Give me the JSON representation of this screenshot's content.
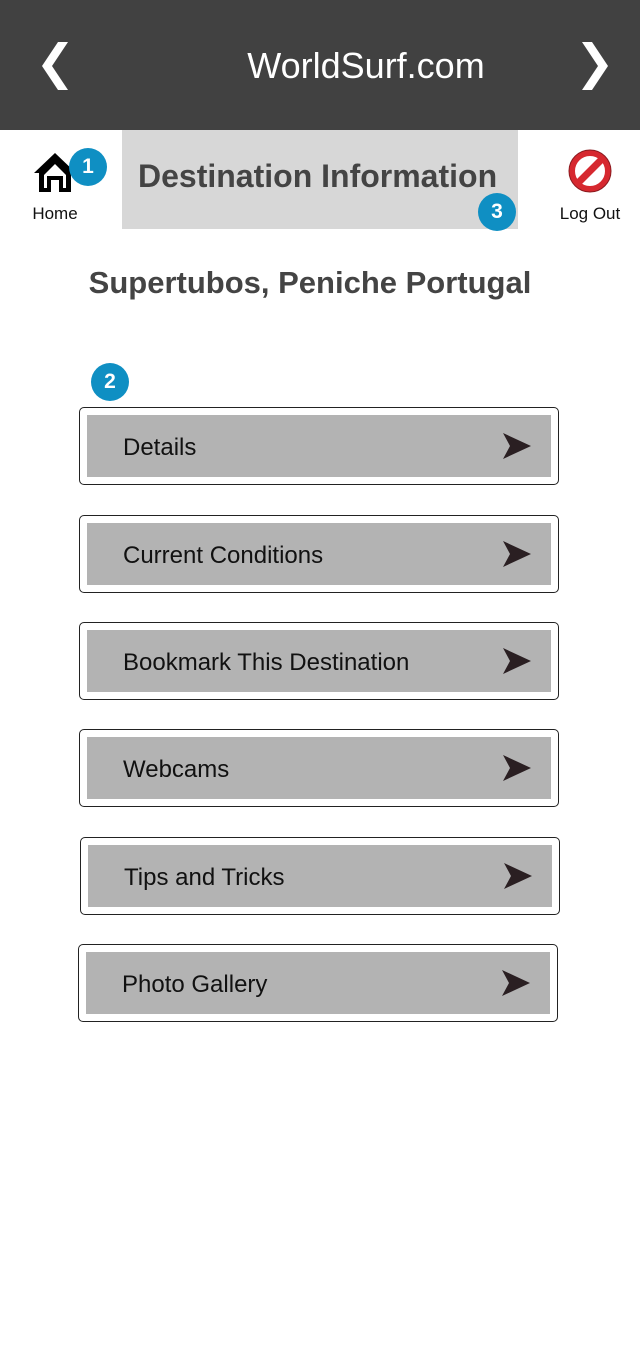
{
  "header": {
    "title": "WorldSurf.com",
    "back_icon": "chevron-left-icon",
    "forward_icon": "chevron-right-icon",
    "background": "#414141"
  },
  "subheader": {
    "home_label": "Home",
    "page_title": "Destination Information",
    "logout_label": "Log Out"
  },
  "badges": [
    "1",
    "2",
    "3"
  ],
  "location": "Supertubos, Peniche Portugal",
  "menu": [
    {
      "label": "Details"
    },
    {
      "label": "Current Conditions"
    },
    {
      "label": "Bookmark This Destination"
    },
    {
      "label": "Webcams"
    },
    {
      "label": "Tips and Tricks"
    },
    {
      "label": "Photo Gallery"
    }
  ],
  "colors": {
    "badge": "#0f8fc3",
    "menu_fill": "#b3b3b3",
    "title_box": "#d7d7d7",
    "logout_red": "#d6282f"
  }
}
